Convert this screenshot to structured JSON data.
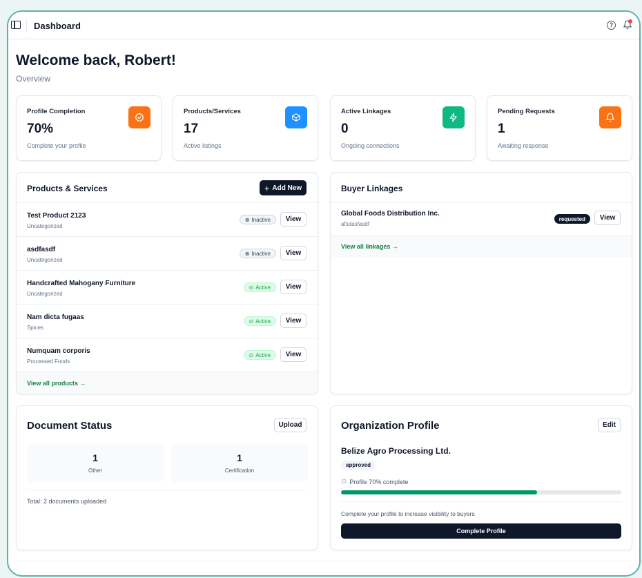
{
  "topbar": {
    "title": "Dashboard"
  },
  "header": {
    "welcome": "Welcome back, Robert!",
    "subtitle": "Overview"
  },
  "stats": [
    {
      "label": "Profile Completion",
      "value": "70%",
      "sub": "Complete your profile",
      "icon": "check-circle-icon",
      "color": "#f97316"
    },
    {
      "label": "Products/Services",
      "value": "17",
      "sub": "Active listings",
      "icon": "package-icon",
      "color": "#1e90ff"
    },
    {
      "label": "Active Linkages",
      "value": "0",
      "sub": "Ongoing connections",
      "icon": "bolt-icon",
      "color": "#10b981"
    },
    {
      "label": "Pending Requests",
      "value": "1",
      "sub": "Awaiting response",
      "icon": "bell-icon",
      "color": "#f97316"
    }
  ],
  "products": {
    "title": "Products & Services",
    "add_label": "Add New",
    "view_label": "View",
    "items": [
      {
        "name": "Test Product 2123",
        "category": "Uncategorized",
        "status": "Inactive"
      },
      {
        "name": "asdfasdf",
        "category": "Uncategorized",
        "status": "Inactive"
      },
      {
        "name": "Handcrafted Mahogany Furniture",
        "category": "Uncategorized",
        "status": "Active"
      },
      {
        "name": "Nam dicta fugaas",
        "category": "Spices",
        "status": "Active"
      },
      {
        "name": "Numquam corporis",
        "category": "Processed Foods",
        "status": "Active"
      }
    ],
    "view_all": "View all products →"
  },
  "linkages": {
    "title": "Buyer Linkages",
    "items": [
      {
        "name": "Global Foods Distribution Inc.",
        "sub": "afsdasfasdf",
        "status": "requested",
        "view_label": "View"
      }
    ],
    "view_all": "View all linkages →"
  },
  "documents": {
    "title": "Document Status",
    "upload_label": "Upload",
    "boxes": [
      {
        "count": "1",
        "label": "Other"
      },
      {
        "count": "1",
        "label": "Certification"
      }
    ],
    "total": "Total: 2 documents uploaded"
  },
  "organization": {
    "title": "Organization Profile",
    "edit_label": "Edit",
    "name": "Belize Agro Processing Ltd.",
    "status": "approved",
    "progress_text": "Profile 70% complete",
    "progress": 0.7,
    "hint": "Complete your profile to increase visibility to buyers",
    "cta": "Complete Profile"
  }
}
